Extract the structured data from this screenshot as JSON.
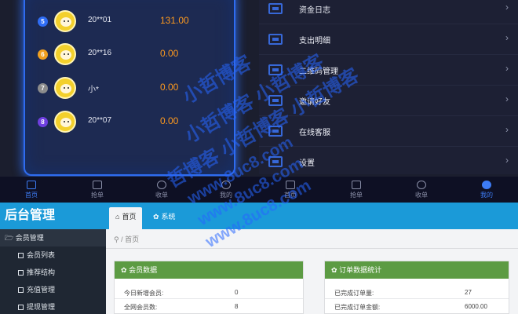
{
  "ranking": [
    {
      "rank": "5",
      "name": "20**01",
      "amount": "131.00",
      "rank_color": "#2f6df5"
    },
    {
      "rank": "6",
      "name": "20**16",
      "amount": "0.00",
      "rank_color": "#f0a020"
    },
    {
      "rank": "7",
      "name": "小*",
      "amount": "0.00",
      "rank_color": "#8c8c8c"
    },
    {
      "rank": "8",
      "name": "20**07",
      "amount": "0.00",
      "rank_color": "#6f3fe0"
    }
  ],
  "menu": [
    {
      "label": "资金日志"
    },
    {
      "label": "支出明细"
    },
    {
      "label": "二维码管理"
    },
    {
      "label": "邀请好友"
    },
    {
      "label": "在线客服"
    },
    {
      "label": "设置"
    }
  ],
  "tabbar_left": [
    {
      "label": "首页",
      "icon": "home-icon"
    },
    {
      "label": "抢单",
      "icon": "envelope-icon"
    },
    {
      "label": "收单",
      "icon": "gear-icon"
    },
    {
      "label": "我的",
      "icon": "user-icon"
    }
  ],
  "tabbar_right": [
    {
      "label": "首页",
      "icon": "home-icon"
    },
    {
      "label": "抢单",
      "icon": "envelope-icon"
    },
    {
      "label": "收单",
      "icon": "gear-icon"
    },
    {
      "label": "我的",
      "icon": "user-icon"
    }
  ],
  "admin": {
    "brand": "后台管理",
    "tabs": [
      "首页",
      "系统"
    ],
    "breadcrumb": "首页",
    "sidebar_group": "会员管理",
    "sidebar_items": [
      "会员列表",
      "推荐结构",
      "充值管理",
      "提现管理"
    ],
    "cards": [
      {
        "title": "会员数据",
        "rows": [
          {
            "label": "今日新增会员:",
            "value": "0"
          },
          {
            "label": "全网会员数:",
            "value": "8"
          }
        ]
      },
      {
        "title": "订单数据统计",
        "rows": [
          {
            "label": "已完成订单量:",
            "value": "27"
          },
          {
            "label": "已完成订单金额:",
            "value": "6000.00"
          }
        ]
      }
    ]
  },
  "watermark": {
    "lines": [
      "小哲博客",
      "小哲博客 小哲博客",
      "哲博客 小哲博客 小哲博客",
      "www.8uc8.com",
      "www.8uc8.com",
      "www.8uc8.com"
    ]
  },
  "colors": {
    "accent": "#1b9ad8",
    "card_head": "#5c9b43",
    "amount": "#ff9a1e",
    "tab_active": "#3d7cf5"
  }
}
